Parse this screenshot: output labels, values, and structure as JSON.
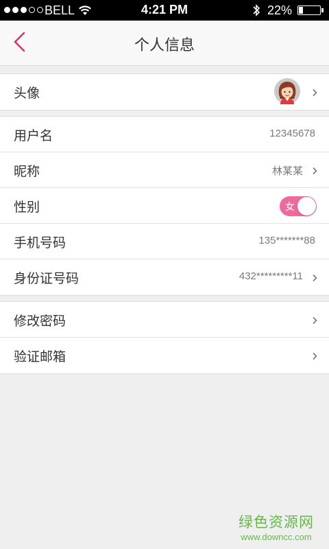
{
  "status_bar": {
    "carrier": "BELL",
    "time": "4:21 PM",
    "battery_text": "22%",
    "battery_level": 0.22,
    "icons": [
      "signal-dots-icon",
      "wifi-icon",
      "bluetooth-icon",
      "battery-icon"
    ]
  },
  "nav": {
    "title": "个人信息",
    "back_icon": "chevron-left-icon"
  },
  "groups": {
    "avatar": {
      "label": "头像",
      "icon": "avatar-girl-icon"
    },
    "profile": {
      "username_label": "用户名",
      "username_value": "12345678",
      "nickname_label": "昵称",
      "nickname_value": "林某某",
      "gender_label": "性别",
      "gender_value": "女",
      "phone_label": "手机号码",
      "phone_value": "135*******88",
      "id_label": "身份证号码",
      "id_value": "432*********11"
    },
    "security": {
      "password_label": "修改密码",
      "email_label": "验证邮箱"
    }
  },
  "watermark": {
    "title": "绿色资源网",
    "url": "www.downcc.com"
  },
  "colors": {
    "accent": "#d9336e",
    "toggle_on": "#ec6b9c",
    "background": "#efefef",
    "watermark": "#69b54c"
  }
}
